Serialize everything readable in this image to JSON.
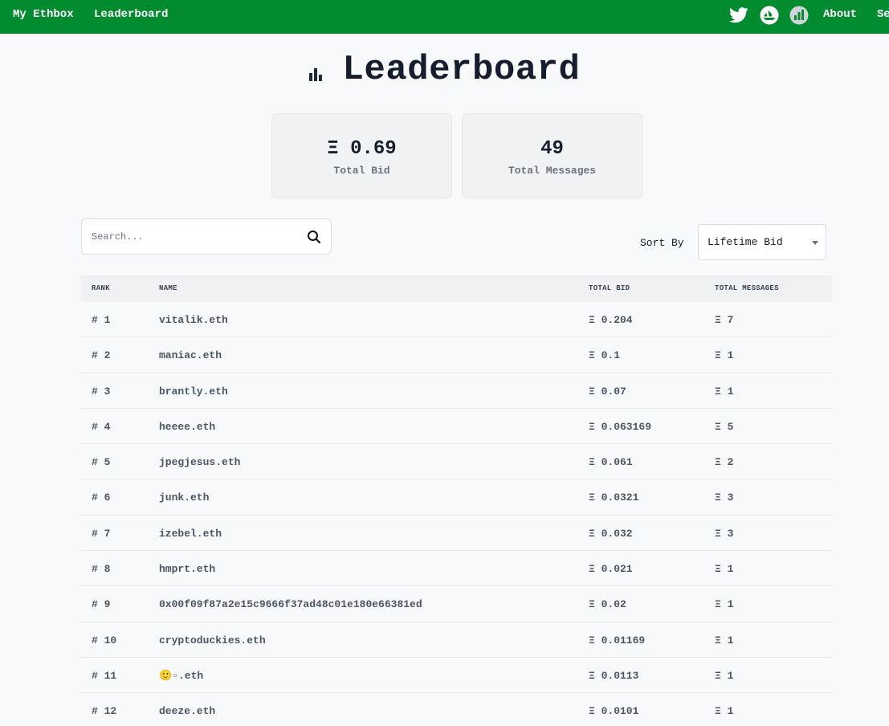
{
  "nav": {
    "links": [
      "My Ethbox",
      "Leaderboard"
    ],
    "about": "About",
    "truncated": "Se",
    "icons": [
      "twitter-icon",
      "opensea-icon",
      "chart-icon"
    ]
  },
  "page": {
    "title": "Leaderboard"
  },
  "stats": [
    {
      "value": "Ξ 0.69",
      "label": "Total Bid"
    },
    {
      "value": "49",
      "label": "Total Messages"
    }
  ],
  "search": {
    "placeholder": "Search...",
    "value": ""
  },
  "sort": {
    "label": "Sort By",
    "selected": "Lifetime Bid"
  },
  "table": {
    "headers": [
      "RANK",
      "NAME",
      "TOTAL BID",
      "TOTAL MESSAGES"
    ],
    "rows": [
      {
        "rank": "# 1",
        "name": "vitalik.eth",
        "bid": "Ξ 0.204",
        "messages": "Ξ 7"
      },
      {
        "rank": "# 2",
        "name": "maniac.eth",
        "bid": "Ξ 0.1",
        "messages": "Ξ 1"
      },
      {
        "rank": "# 3",
        "name": "brantly.eth",
        "bid": "Ξ 0.07",
        "messages": "Ξ 1"
      },
      {
        "rank": "# 4",
        "name": "heeee.eth",
        "bid": "Ξ 0.063169",
        "messages": "Ξ 5"
      },
      {
        "rank": "# 5",
        "name": "jpegjesus.eth",
        "bid": "Ξ 0.061",
        "messages": "Ξ 2"
      },
      {
        "rank": "# 6",
        "name": "junk.eth",
        "bid": "Ξ 0.0321",
        "messages": "Ξ 3"
      },
      {
        "rank": "# 7",
        "name": "izebel.eth",
        "bid": "Ξ 0.032",
        "messages": "Ξ 3"
      },
      {
        "rank": "# 8",
        "name": "hmprt.eth",
        "bid": "Ξ 0.021",
        "messages": "Ξ 1"
      },
      {
        "rank": "# 9",
        "name": "0x00f09f87a2e15c9666f37ad48c01e180e66381ed",
        "bid": "Ξ 0.02",
        "messages": "Ξ 1"
      },
      {
        "rank": "# 10",
        "name": "cryptoduckies.eth",
        "bid": "Ξ 0.01169",
        "messages": "Ξ 1"
      },
      {
        "rank": "# 11",
        "name": "🙂▫.eth",
        "bid": "Ξ 0.0113",
        "messages": "Ξ 1"
      },
      {
        "rank": "# 12",
        "name": "deeze.eth",
        "bid": "Ξ 0.0101",
        "messages": "Ξ 1"
      }
    ]
  }
}
